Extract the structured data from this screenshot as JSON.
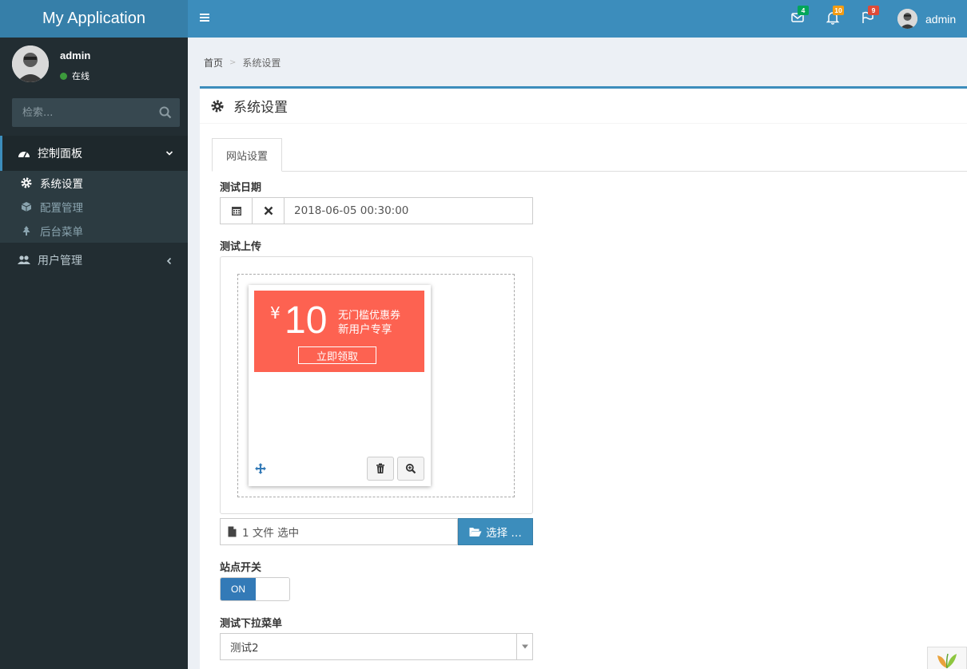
{
  "app": {
    "title": "My Application"
  },
  "header": {
    "messages_count": "4",
    "notifications_count": "10",
    "tasks_count": "9",
    "user_name": "admin",
    "colors": {
      "messages": "#00a65a",
      "notifications": "#f39c12",
      "tasks": "#dd4b39"
    }
  },
  "sidebar": {
    "user": {
      "name": "admin",
      "status": "在线"
    },
    "search": {
      "placeholder": "检索..."
    },
    "menu": {
      "dashboard": {
        "label": "控制面板"
      },
      "sub_items": [
        {
          "label": "系统设置",
          "icon": "gear-icon"
        },
        {
          "label": "配置管理",
          "icon": "cube-icon"
        },
        {
          "label": "后台菜单",
          "icon": "tree-icon"
        }
      ],
      "users": {
        "label": "用户管理"
      }
    }
  },
  "breadcrumb": {
    "home": "首页",
    "current": "系统设置"
  },
  "box": {
    "title": "系统设置"
  },
  "tabs": [
    {
      "label": "网站设置"
    }
  ],
  "form": {
    "date": {
      "label": "测试日期",
      "value": "2018-06-05 00:30:00"
    },
    "upload": {
      "label": "测试上传",
      "coupon": {
        "currency": "¥",
        "amount": "10",
        "line1": "无门槛优惠券",
        "line2": "新用户专享",
        "button": "立即领取"
      },
      "caption": "1 文件 选中",
      "browse_label": "选择 …"
    },
    "switch": {
      "label": "站点开关",
      "on_label": "ON"
    },
    "select": {
      "label": "测试下拉菜单",
      "value": "测试2"
    }
  }
}
